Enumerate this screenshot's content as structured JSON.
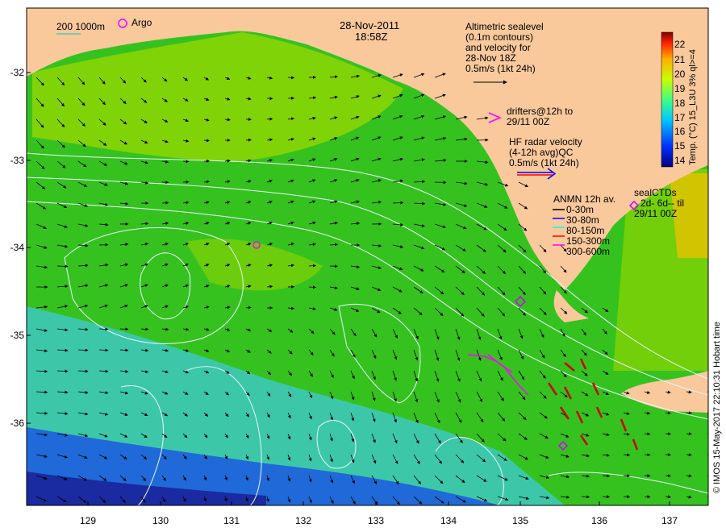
{
  "map": {
    "date": "28-Nov-2011",
    "time": "18:58Z",
    "y_ticks": [
      "-32",
      "-33",
      "-34",
      "-35",
      "-36"
    ],
    "x_ticks": [
      "129",
      "130",
      "131",
      "132",
      "133",
      "134",
      "135",
      "136",
      "137"
    ],
    "lon_range": [
      128.2,
      137.6
    ],
    "lat_range": [
      -36.9,
      -31.35
    ]
  },
  "legend": {
    "scale_label": "200  1000m",
    "argo_label": "Argo",
    "altimetric": [
      "Altimetric sealevel",
      "(0.1m contours)",
      "and velocity for",
      "28-Nov 18Z",
      "0.5m/s (1kt 24h)"
    ],
    "drifters": [
      "drifters@12h to",
      "29/11 00Z"
    ],
    "drifter_marker": ">",
    "hf_radar": [
      "HF radar velocity",
      "(4-12h avg)QC",
      "0.5m/s (1kt 24h)"
    ],
    "anmn_title": "ANMN 12h av.",
    "anmn_depths": [
      {
        "label": "0-30m",
        "color": "#000000"
      },
      {
        "label": "30-80m",
        "color": "#0000ff"
      },
      {
        "label": "80-150m",
        "color": "#00ffff"
      },
      {
        "label": "150-300m",
        "color": "#ff0000"
      },
      {
        "label": "300-600m",
        "color": "#ff00ff"
      }
    ],
    "seal": [
      "sealCTDs",
      "2d-  6d-- til",
      "29/11 00Z"
    ]
  },
  "colorbar": {
    "ticks": [
      "22",
      "21",
      "20",
      "19",
      "18",
      "17",
      "16",
      "15",
      "14"
    ],
    "title": "Temp. (°C) 15_L3U 3% ql>=4"
  },
  "credit": "© IMOS 15-May-2017 22:10:31 Hobart time",
  "colors": {
    "land": "#f9c89b",
    "green": "#35c21f",
    "yellow_green": "#a8e000",
    "cyan": "#38c8b0",
    "blue": "#1a4fd0",
    "dark_blue": "#1a1a9a",
    "contour": "#e8f4ff",
    "drifter": "#ff00ff",
    "seal": "#cc00ff"
  }
}
